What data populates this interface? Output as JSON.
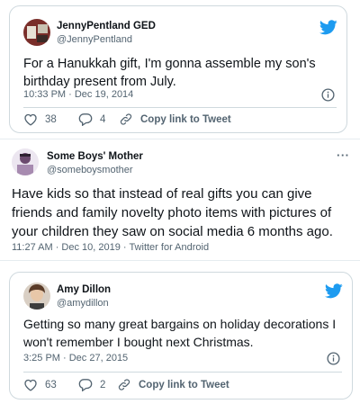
{
  "colors": {
    "twitter_blue": "#1d9bf0",
    "text": "#0f1419",
    "secondary": "#536471",
    "border": "#cfd9de"
  },
  "tweets": [
    {
      "name": "JennyPentland GED",
      "handle": "@JennyPentland",
      "text": "For a Hanukkah gift, I'm gonna assemble my son's birthday present from July.",
      "meta": "10:33 PM · Dec 19, 2014",
      "likes": "38",
      "replies": "4",
      "copy_label": "Copy link to Tweet"
    },
    {
      "name": "Some Boys' Mother",
      "handle": "@someboysmother",
      "text": "Have kids so that instead of real gifts you can give friends and family novelty photo items with pictures of your children they saw on social media 6 months ago.",
      "meta": "11:27 AM · Dec 10, 2019 · Twitter for Android",
      "more": "···"
    },
    {
      "name": "Amy Dillon",
      "handle": "@amydillon",
      "text": "Getting so many great bargains on holiday decorations I won't remember I bought next Christmas.",
      "meta": "3:25 PM · Dec 27, 2015",
      "likes": "63",
      "replies": "2",
      "copy_label": "Copy link to Tweet"
    }
  ]
}
